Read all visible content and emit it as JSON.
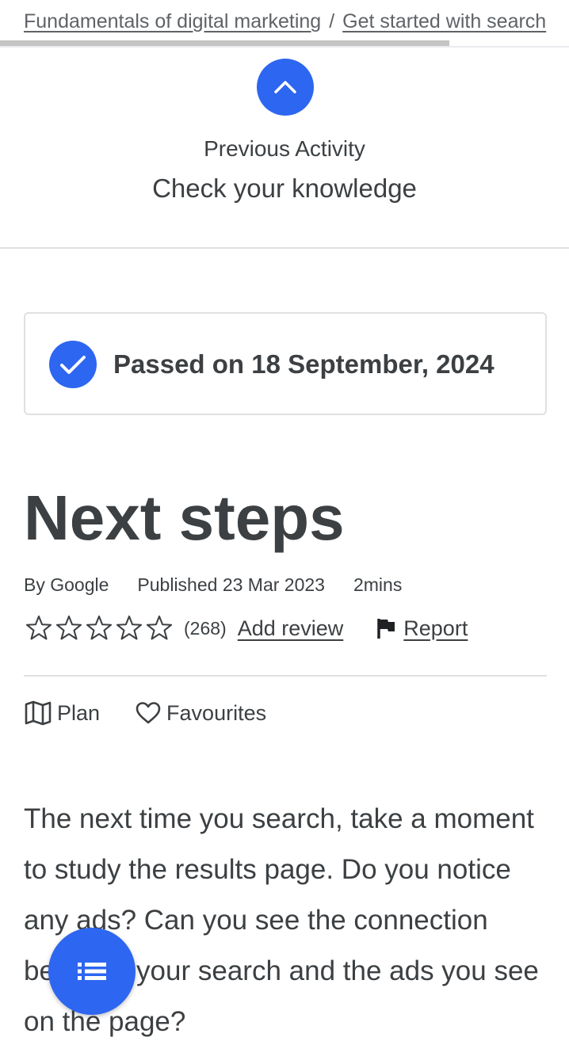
{
  "breadcrumb": {
    "items": [
      "Fundamentals of digital marketing",
      "Get started with search"
    ],
    "separator": "/"
  },
  "progress": {
    "fraction": 0.79
  },
  "previous_activity": {
    "label": "Previous Activity",
    "title": "Check your knowledge",
    "icon": "chevron-up-icon"
  },
  "status": {
    "text": "Passed on 18 September, 2024",
    "icon": "check-icon"
  },
  "lesson": {
    "title": "Next steps",
    "author": "By Google",
    "published": "Published 23 Mar 2023",
    "duration": "2mins",
    "rating": {
      "stars_filled": 0,
      "stars_total": 5,
      "count": "(268)"
    },
    "add_review_label": "Add review",
    "report_label": "Report"
  },
  "actions": {
    "plan_label": "Plan",
    "favourites_label": "Favourites"
  },
  "content": {
    "paragraph": "The next time you search, take a moment to study the results page. Do you notice any ads? Can you see the connection between your search and the ads you see on the page?"
  },
  "fab": {
    "icon": "list-icon"
  },
  "colors": {
    "accent": "#2d66f0",
    "text": "#3c4043",
    "divider": "#e0e0e0"
  }
}
